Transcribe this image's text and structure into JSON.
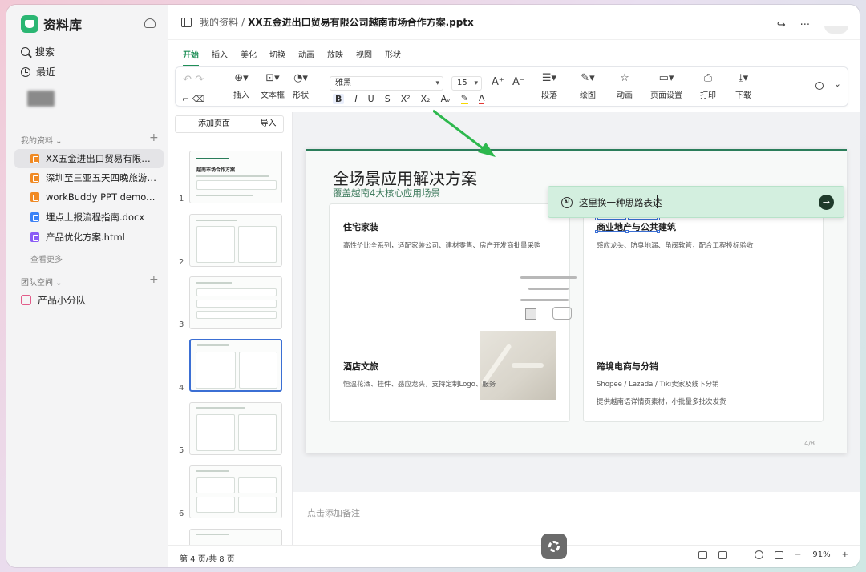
{
  "app": {
    "name": "资料库"
  },
  "sidebar": {
    "search_label": "搜索",
    "recent_label": "最近",
    "my_files_head": "我的资料",
    "files": [
      {
        "name": "XX五金进出口贸易有限公...",
        "type": "ppt"
      },
      {
        "name": "深圳至三亚五天四晚旅游计...",
        "type": "ppt"
      },
      {
        "name": "workBuddy PPT demo.pptx",
        "type": "ppt"
      },
      {
        "name": "埋点上报流程指南.docx",
        "type": "doc"
      },
      {
        "name": "产品优化方案.html",
        "type": "html"
      }
    ],
    "more_label": "查看更多",
    "team_head": "团队空间",
    "team_item": "产品小分队"
  },
  "breadcrumb": {
    "parent": "我的资料",
    "sep": "/",
    "title": "XX五金进出口贸易有限公司越南市场合作方案.pptx"
  },
  "tabs": [
    "开始",
    "插入",
    "美化",
    "切换",
    "动画",
    "放映",
    "视图",
    "形状"
  ],
  "ribbon": {
    "insert_label": "插入",
    "textbox_label": "文本框",
    "shape_label": "形状",
    "font_name": "雅黑",
    "font_size": "15",
    "para_label": "段落",
    "draw_label": "绘图",
    "anim_label": "动画",
    "page_setup_label": "页面设置",
    "print_label": "打印",
    "download_label": "下载",
    "bold": "B",
    "italic": "I",
    "underline": "U",
    "strike": "S",
    "sup": "X²",
    "sub": "X₂",
    "case": "Aᵥ",
    "color": "A"
  },
  "thumbs": {
    "add_page": "添加页面",
    "import": "导入",
    "numbers": [
      "1",
      "2",
      "3",
      "4",
      "5",
      "6"
    ],
    "slide1_title": "越南市场合作方案"
  },
  "slide": {
    "title": "全场景应用解决方案",
    "subtitle": "覆盖越南4大核心应用场景",
    "cards": [
      {
        "title": "住宅家装",
        "desc": "高性价比全系列，适配家装公司、建材零售、房产开发商批量采购"
      },
      {
        "title": "商业地产与公共建筑",
        "desc": "感应龙头、防臭地漏、角阀软管，配合工程投标验收"
      },
      {
        "title": "酒店文旅",
        "desc": "恒温花洒、挂件、感应龙头，支持定制Logo、服务"
      },
      {
        "title": "跨境电商与分销",
        "desc": "Shopee / Lazada / Tiki卖家及线下分销",
        "desc2": "提供越南语详情页素材，小批量多批次发货"
      }
    ],
    "page": "4/8"
  },
  "ai_bar": {
    "text": "这里换一种思路表达",
    "icon": "ai-icon"
  },
  "notes_placeholder": "点击添加备注",
  "status": {
    "page": "第 4 页/共 8 页",
    "zoom": "91%"
  },
  "colors": {
    "accent": "#1f8f57",
    "ai_bg": "#d3efdf",
    "selection": "#3b6fd4",
    "arrow": "#2db84d"
  }
}
